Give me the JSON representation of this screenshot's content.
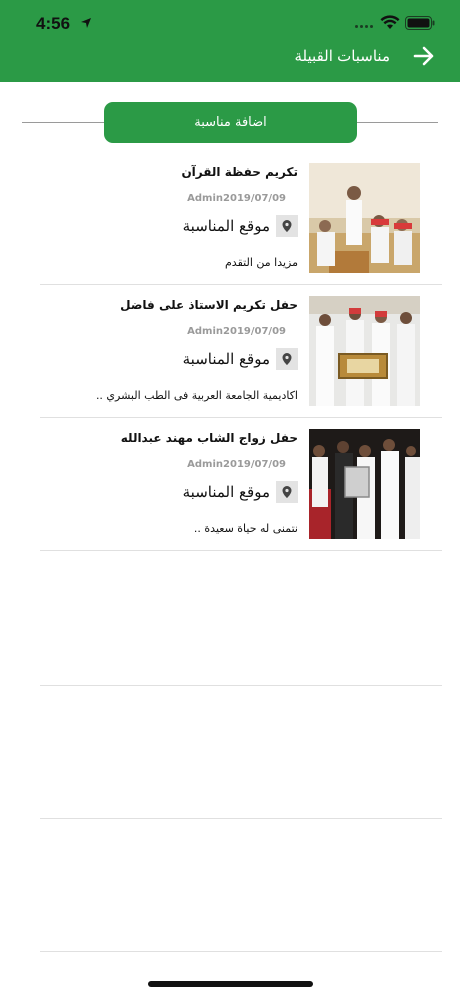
{
  "status_bar": {
    "time": "4:56"
  },
  "header": {
    "title": "مناسبات القبيلة",
    "back_icon": "arrow-right-icon"
  },
  "actions": {
    "add_event_label": "اضافة مناسبة"
  },
  "events": [
    {
      "title": "تكريم حفظة القرآن",
      "author": "Admin",
      "date": "2019/07/09",
      "location_label": "موقع المناسبة",
      "description": "مزيدا من التقدم",
      "image": "event-photo-quran"
    },
    {
      "title": "حفل تكريم الاستاذ على فاضل",
      "author": "Admin",
      "date": "2019/07/09",
      "location_label": "موقع المناسبة",
      "description": "اكاديمية الجامعة العربية فى الطب البشري ..",
      "image": "event-photo-honor"
    },
    {
      "title": "حفل زواج الشاب مهند عبدالله",
      "author": "Admin",
      "date": "2019/07/09",
      "location_label": "موقع المناسبة",
      "description": "نتمنى له حياة سعيدة ..",
      "image": "event-photo-wedding"
    }
  ],
  "colors": {
    "brand_green": "#2b9a46",
    "meta_gray": "#9a9a9a"
  }
}
